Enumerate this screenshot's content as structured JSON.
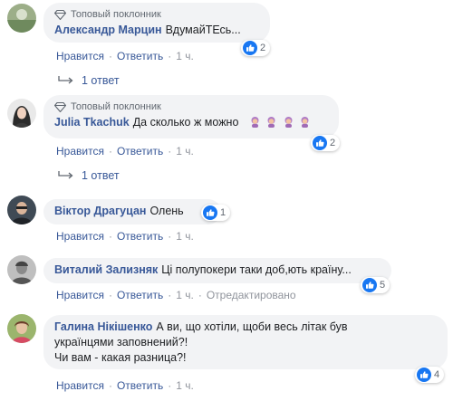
{
  "comments": [
    {
      "badge": "Топовый поклонник",
      "author": "Александр Марцин",
      "text": "ВдумайТЕсь...",
      "reactions": "2",
      "actions": {
        "like": "Нравится",
        "reply": "Ответить",
        "time": "1 ч."
      },
      "replies": "1 ответ"
    },
    {
      "badge": "Топовый поклонник",
      "author": "Julia Tkachuk",
      "text": "Да сколько ж можно",
      "emoji_count": 4,
      "reactions": "2",
      "actions": {
        "like": "Нравится",
        "reply": "Ответить",
        "time": "1 ч."
      },
      "replies": "1 ответ"
    },
    {
      "author": "Віктор Драгуцан",
      "text": "Олень",
      "reactions": "1",
      "actions": {
        "like": "Нравится",
        "reply": "Ответить",
        "time": "1 ч."
      }
    },
    {
      "author": "Виталий Зализняк",
      "text": "Ці полупокери таки доб,ють країну...",
      "reactions": "5",
      "actions": {
        "like": "Нравится",
        "reply": "Ответить",
        "time": "1 ч.",
        "edited": "Отредактировано"
      }
    },
    {
      "author": "Галина Нікішенко",
      "text_line1": "А ви, що хотіли, щоби весь літак був",
      "text_line2": "українцями заповнений?!",
      "text_line3": "Чи вам - какая разница?!",
      "reactions": "4",
      "actions": {
        "like": "Нравится",
        "reply": "Ответить",
        "time": "1 ч."
      }
    }
  ],
  "colors": {
    "link": "#385898",
    "bubble": "#f2f3f5",
    "like_blue": "#1877f2",
    "meta": "#90949c"
  },
  "icons": {
    "badge": "diamond-icon",
    "reaction": "like-icon",
    "reply_arrow": "reply-arrow-icon",
    "emoji": "woman-facepalming-emoji"
  }
}
